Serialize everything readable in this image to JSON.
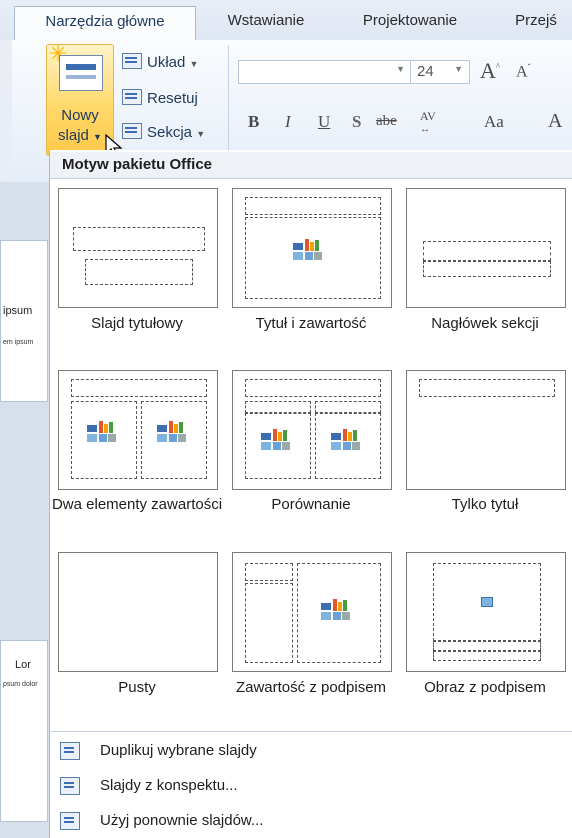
{
  "tabs": [
    "Narzędzia główne",
    "Wstawianie",
    "Projektowanie",
    "Przejś"
  ],
  "ribbon": {
    "new_slide_line1": "Nowy",
    "new_slide_line2": "slajd",
    "layout": "Układ",
    "reset": "Resetuj",
    "section": "Sekcja",
    "font_size": "24",
    "bold": "B",
    "italic": "I",
    "underline": "U",
    "shadow": "S",
    "strike": "abe",
    "spacing": "AV",
    "case": "Aa",
    "grow": "A",
    "shrink": "A"
  },
  "gallery": {
    "header": "Motyw pakietu Office",
    "layouts": [
      {
        "label": "Slajd tytułowy"
      },
      {
        "label": "Tytuł i zawartość"
      },
      {
        "label": "Nagłówek sekcji"
      },
      {
        "label": "Dwa elementy zawartości"
      },
      {
        "label": "Porównanie"
      },
      {
        "label": "Tylko tytuł"
      },
      {
        "label": "Pusty"
      },
      {
        "label": "Zawartość z podpisem"
      },
      {
        "label": "Obraz z podpisem"
      }
    ]
  },
  "menu": [
    {
      "label": "Duplikuj wybrane slajdy"
    },
    {
      "label": "Slajdy z konspektu..."
    },
    {
      "label": "Użyj ponownie slajdów..."
    }
  ],
  "pane": {
    "snip1": "ipsum",
    "snip2": "em ipsum",
    "snip3": "Lor",
    "snip4": "psum dolor"
  },
  "colors": {
    "accent": "#ffc94a",
    "ribbon": "#dfe7f3",
    "border": "#a9bad3"
  }
}
